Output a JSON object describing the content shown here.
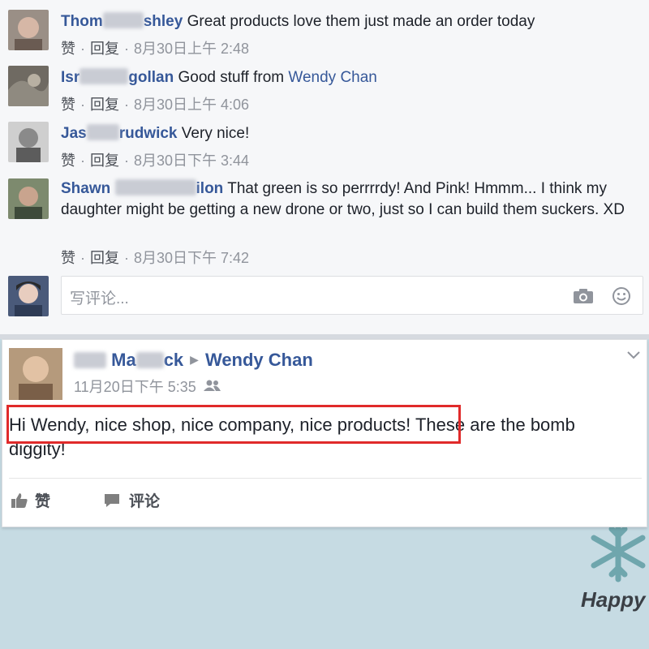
{
  "comments": [
    {
      "author_visible": "Thom",
      "author_visible_end": "shley",
      "text": "Great products love them just made an order today",
      "like": "赞",
      "reply": "回复",
      "time": "8月30日上午 2:48"
    },
    {
      "author_visible": "Isr",
      "author_visible_end": "gollan",
      "text": "Good stuff from",
      "mention": "Wendy Chan",
      "like": "赞",
      "reply": "回复",
      "time": "8月30日上午 4:06"
    },
    {
      "author_visible": "Jas",
      "author_visible_end": "rudwick",
      "text": "Very nice!",
      "like": "赞",
      "reply": "回复",
      "time": "8月30日下午 3:44"
    },
    {
      "author_visible": "Shawn",
      "author_visible_end": "ilon",
      "text": "That green is so perrrrdy! And Pink! Hmmm... I think my daughter might be getting a new drone or two, just so I can build them suckers. XD",
      "like": "赞",
      "reply": "回复",
      "time": "8月30日下午 7:42"
    }
  ],
  "write_comment": {
    "placeholder": "写评论..."
  },
  "post": {
    "author_visible": "Ma",
    "author_visible_end": "ck",
    "target": "Wendy Chan",
    "time": "11月20日下午 5:35",
    "body": "Hi Wendy, nice shop, nice company, nice products! These are the bomb diggity!",
    "like_label": "赞",
    "comment_label": "评论"
  },
  "background_text": "Happy N",
  "colors": {
    "link": "#365899",
    "highlight": "#e02a2a",
    "meta": "#90949c"
  }
}
